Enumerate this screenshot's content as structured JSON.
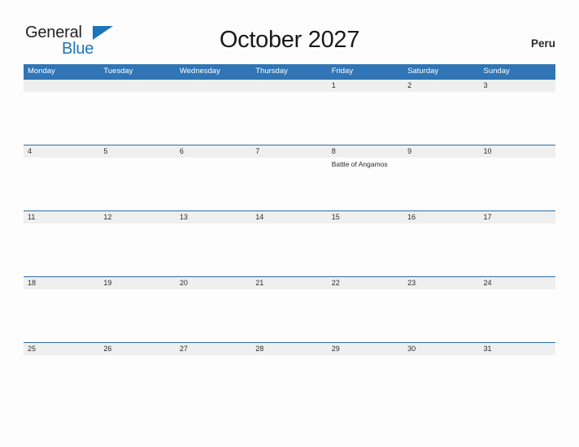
{
  "logo": {
    "word_one": "General",
    "word_two": "Blue",
    "triangle_color": "#1B75BC"
  },
  "header": {
    "title": "October 2027",
    "region": "Peru"
  },
  "theme": {
    "header_blue": "#3075B5",
    "rule_blue": "#2E6DA4",
    "date_strip_gray": "#EFEFEF",
    "page_background": "#FDFDFD",
    "text_color": "#2B2B2B"
  },
  "calendar": {
    "day_names": [
      "Monday",
      "Tuesday",
      "Wednesday",
      "Thursday",
      "Friday",
      "Saturday",
      "Sunday"
    ],
    "weeks": [
      {
        "dates": [
          "",
          "",
          "",
          "",
          "1",
          "2",
          "3"
        ],
        "events": [
          "",
          "",
          "",
          "",
          "",
          "",
          ""
        ]
      },
      {
        "dates": [
          "4",
          "5",
          "6",
          "7",
          "8",
          "9",
          "10"
        ],
        "events": [
          "",
          "",
          "",
          "",
          "Battle of Angamos",
          "",
          ""
        ]
      },
      {
        "dates": [
          "11",
          "12",
          "13",
          "14",
          "15",
          "16",
          "17"
        ],
        "events": [
          "",
          "",
          "",
          "",
          "",
          "",
          ""
        ]
      },
      {
        "dates": [
          "18",
          "19",
          "20",
          "21",
          "22",
          "23",
          "24"
        ],
        "events": [
          "",
          "",
          "",
          "",
          "",
          "",
          ""
        ]
      },
      {
        "dates": [
          "25",
          "26",
          "27",
          "28",
          "29",
          "30",
          "31"
        ],
        "events": [
          "",
          "",
          "",
          "",
          "",
          "",
          ""
        ]
      }
    ]
  }
}
